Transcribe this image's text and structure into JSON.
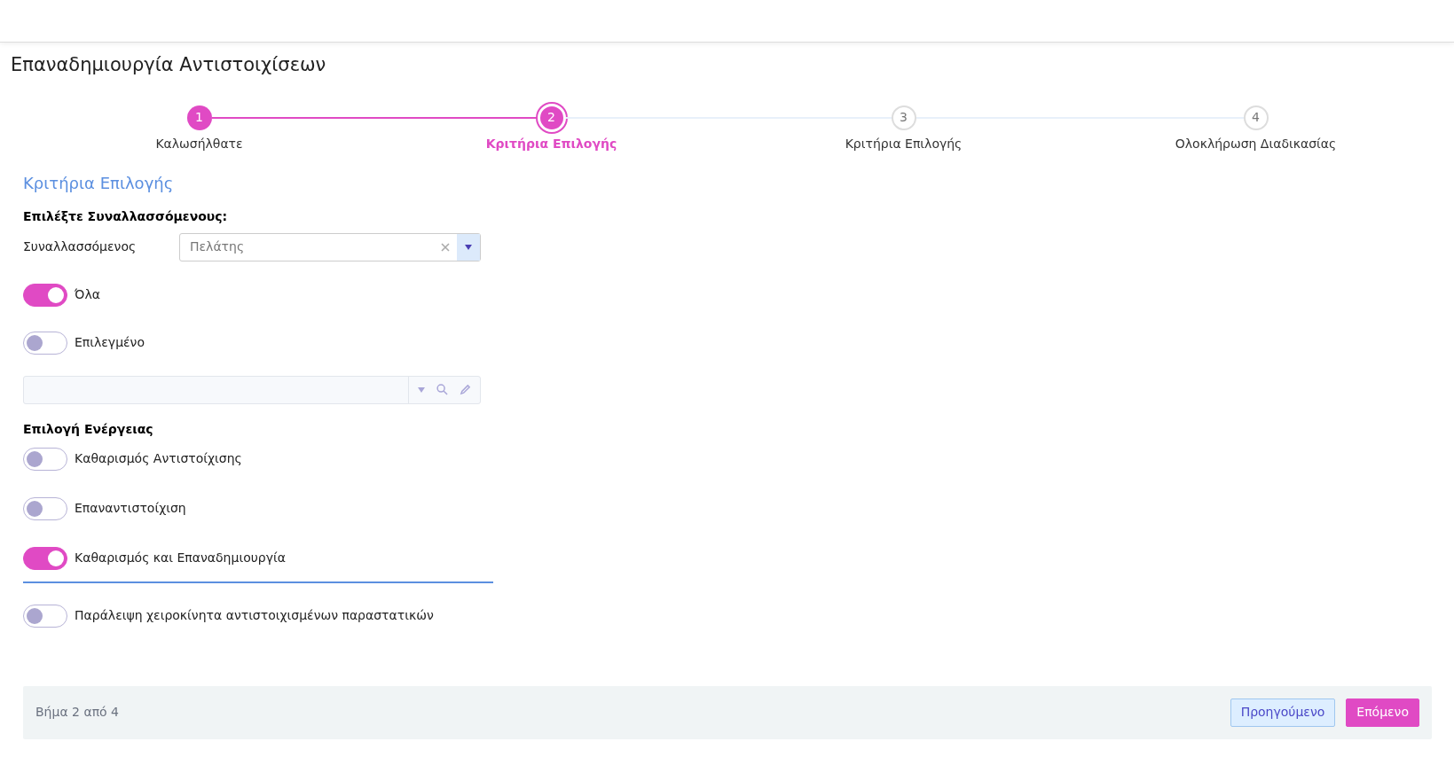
{
  "title": "Επαναδημιουργία Αντιστοιχίσεων",
  "steps": [
    {
      "number": "1",
      "label": "Καλωσήλθατε",
      "done": true,
      "selected": false
    },
    {
      "number": "2",
      "label": "Κριτήρια Επιλογής",
      "done": false,
      "selected": true
    },
    {
      "number": "3",
      "label": "Κριτήρια Επιλογής",
      "done": false,
      "selected": false
    },
    {
      "number": "4",
      "label": "Ολοκλήρωση Διαδικασίας",
      "done": false,
      "selected": false
    }
  ],
  "section_title": "Κριτήρια Επιλογής",
  "party_heading": "Επιλέξτε Συναλλασσόμενους:",
  "party_field": {
    "label": "Συναλλασσόμενος",
    "value": "Πελάτης"
  },
  "party_toggles": [
    {
      "label": "Όλα",
      "on": true
    },
    {
      "label": "Επιλεγμένο",
      "on": false
    }
  ],
  "action_heading": "Επιλογή Ενέργειας",
  "action_toggles": [
    {
      "label": "Καθαρισμός Αντιστοίχισης",
      "on": false
    },
    {
      "label": "Επαναντιστοίχιση",
      "on": false
    },
    {
      "label": "Καθαρισμός και Επαναδημιουργία",
      "on": true
    }
  ],
  "extra_toggles": [
    {
      "label": "Παράλειψη χειροκίνητα αντιστοιχισμένων παραστατικών",
      "on": false
    }
  ],
  "footer": {
    "step_text": "Βήμα 2 από 4",
    "buttons": [
      {
        "label": "Προηγούμενο",
        "kind": "secondary"
      },
      {
        "label": "Επόμενο",
        "kind": "primary"
      }
    ]
  }
}
